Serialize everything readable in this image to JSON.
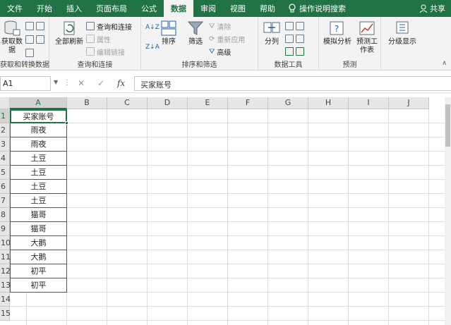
{
  "tabs": [
    "文件",
    "开始",
    "插入",
    "页面布局",
    "公式",
    "数据",
    "审阅",
    "视图",
    "帮助"
  ],
  "tell_me": "操作说明搜索",
  "share": "共享",
  "ribbon": {
    "get_data": "获取数据",
    "group1_label": "获取和转换数据",
    "refresh_all": "全部刷新",
    "queries_connections": "查询和连接",
    "properties": "属性",
    "edit_links": "编辑链接",
    "group2_label": "查询和连接",
    "sort": "排序",
    "filter": "筛选",
    "clear": "清除",
    "reapply": "重新应用",
    "advanced": "高级",
    "group3_label": "排序和筛选",
    "text_to_columns": "分列",
    "group4_label": "数据工具",
    "what_if": "模拟分析",
    "forecast_sheet": "预测工作表",
    "group5_label": "预测",
    "outline": "分级显示"
  },
  "formula_bar": {
    "name_box": "A1",
    "fx": "fx",
    "content": "买家账号"
  },
  "columns": [
    "A",
    "B",
    "C",
    "D",
    "E",
    "F",
    "G",
    "H",
    "I",
    "J"
  ],
  "rows": [
    "1",
    "2",
    "3",
    "4",
    "5",
    "6",
    "7",
    "8",
    "9",
    "10",
    "11",
    "12",
    "13",
    "14",
    "15"
  ],
  "cells_a": [
    "买家账号",
    "雨夜",
    "雨夜",
    "土豆",
    "土豆",
    "土豆",
    "土豆",
    "猫哥",
    "猫哥",
    "大鹅",
    "大鹅",
    "初平",
    "初平"
  ],
  "colors": {
    "accent": "#217346"
  }
}
